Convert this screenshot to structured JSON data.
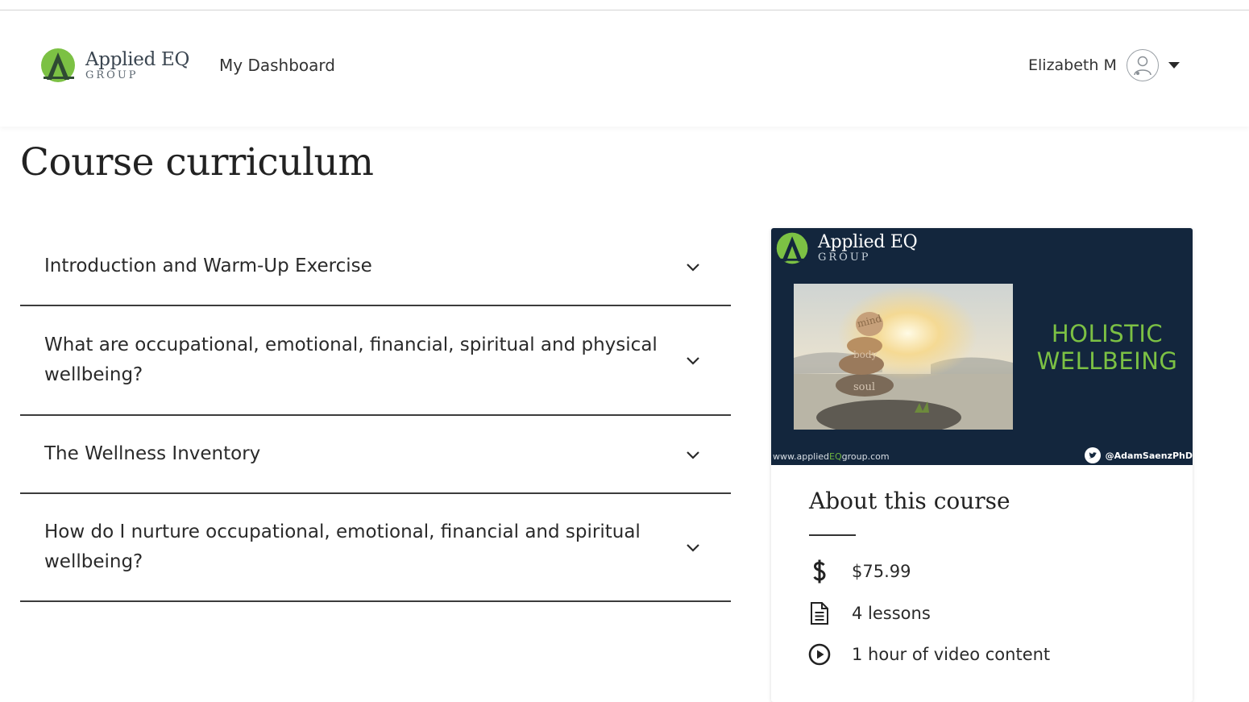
{
  "brand": {
    "name": "Applied EQ",
    "group": "GROUP",
    "accent_green": "#7cc144",
    "navy": "#13263d"
  },
  "nav": {
    "dashboard_label": "My Dashboard"
  },
  "user": {
    "name": "Elizabeth M",
    "avatar_icon": "user-avatar-icon",
    "menu_icon": "caret-down-icon"
  },
  "page": {
    "title": "Course curriculum"
  },
  "curriculum": {
    "sections": [
      {
        "label": "Introduction and Warm-Up Exercise"
      },
      {
        "label": "What are occupational, emotional, financial, spiritual and physical wellbeing?"
      },
      {
        "label": "The Wellness Inventory"
      },
      {
        "label": "How do I nurture occupational, emotional, financial and spiritual wellbeing?"
      }
    ],
    "expand_icon": "chevron-down-icon"
  },
  "course_card": {
    "banner": {
      "brand_name": "Applied EQ",
      "brand_group": "GROUP",
      "stone_words": [
        "mind",
        "body",
        "soul"
      ],
      "headline_line1": "HOLISTIC",
      "headline_line2": "WELLBEING",
      "url_prefix": "www.applied",
      "url_highlight": "EQ",
      "url_suffix": "group.com",
      "handle": "@AdamSaenzPhD"
    },
    "about_title": "About this course",
    "price": "$75.99",
    "lessons": "4 lessons",
    "video": "1 hour of video content",
    "icons": {
      "price": "dollar-icon",
      "lessons": "document-icon",
      "video": "play-circle-icon"
    }
  }
}
